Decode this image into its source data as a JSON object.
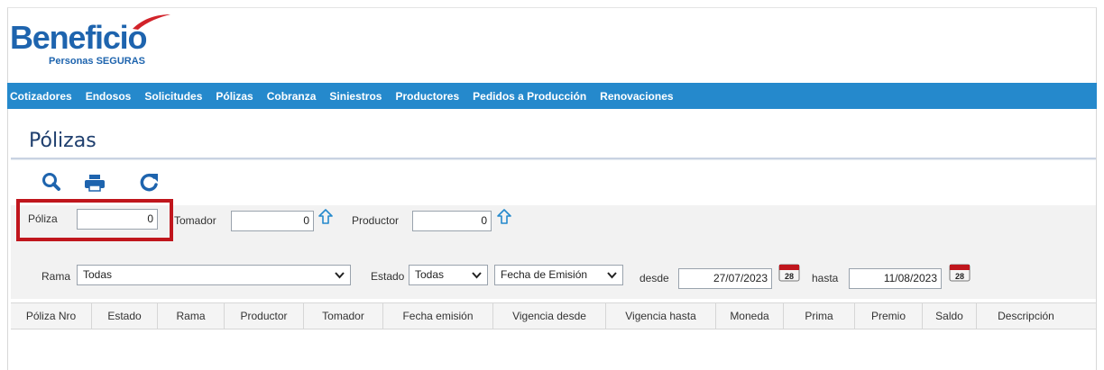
{
  "brand": {
    "name": "Beneficio",
    "tagline": "Personas SEGURAS",
    "primary_color": "#1e64ae",
    "accent_color": "#d2232a"
  },
  "nav": {
    "color": "#2589cc",
    "items": [
      "Cotizadores",
      "Endosos",
      "Solicitudes",
      "Pólizas",
      "Cobranza",
      "Siniestros",
      "Productores",
      "Pedidos a Producción",
      "Renovaciones"
    ]
  },
  "page": {
    "title": "Pólizas"
  },
  "toolbar": {
    "icons": [
      "search-icon",
      "print-icon",
      "refresh-icon"
    ],
    "color": "#1e64ae"
  },
  "filters": {
    "poliza": {
      "label": "Póliza",
      "value": "0"
    },
    "tomador": {
      "label": "Tomador",
      "value": "0"
    },
    "productor": {
      "label": "Productor",
      "value": "0"
    },
    "rama": {
      "label": "Rama",
      "selected": "Todas"
    },
    "estado": {
      "label": "Estado",
      "selected": "Todas"
    },
    "fecha_tipo": {
      "selected": "Fecha de Emisión"
    },
    "desde": {
      "label": "desde",
      "value": "27/07/2023"
    },
    "hasta": {
      "label": "hasta",
      "value": "11/08/2023"
    },
    "calendar_day": "28"
  },
  "table": {
    "columns": [
      "Póliza Nro",
      "Estado",
      "Rama",
      "Productor",
      "Tomador",
      "Fecha emisión",
      "Vigencia desde",
      "Vigencia hasta",
      "Moneda",
      "Prima",
      "Premio",
      "Saldo",
      "Descripción"
    ],
    "rows": []
  }
}
